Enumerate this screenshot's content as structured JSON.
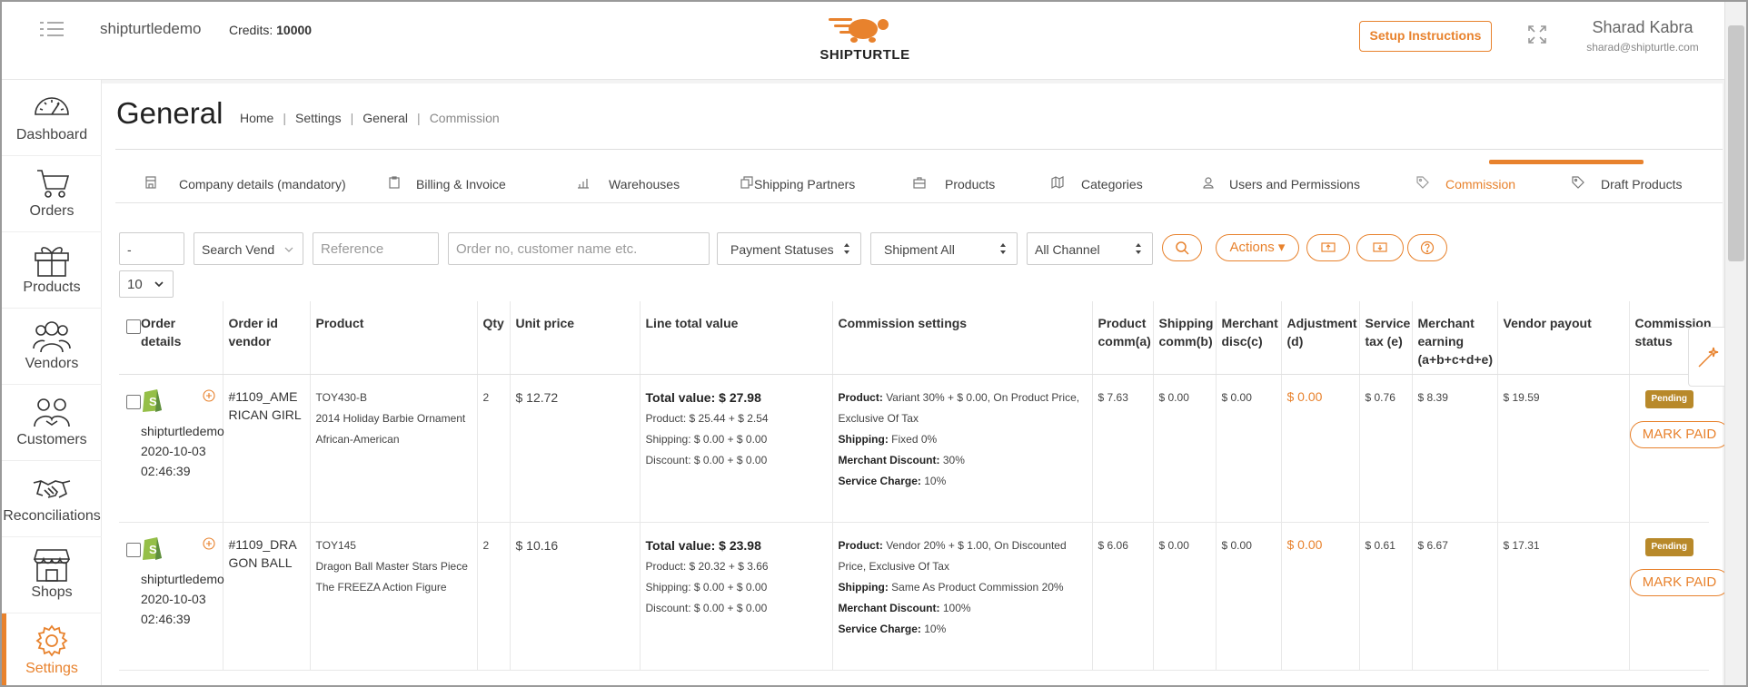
{
  "header": {
    "shop_name": "shipturtledemo",
    "credits_label": "Credits:",
    "credits_value": "10000",
    "logo_text": "SHIPTURTLE",
    "setup_button": "Setup Instructions",
    "user_name": "Sharad Kabra",
    "user_email": "sharad@shipturtle.com"
  },
  "sidebar": {
    "items": [
      {
        "label": "Dashboard",
        "icon": "speedometer-icon"
      },
      {
        "label": "Orders",
        "icon": "cart-icon"
      },
      {
        "label": "Products",
        "icon": "gift-icon"
      },
      {
        "label": "Vendors",
        "icon": "users-icon"
      },
      {
        "label": "Customers",
        "icon": "customers-icon"
      },
      {
        "label": "Reconciliations",
        "icon": "handshake-icon"
      },
      {
        "label": "Shops",
        "icon": "shop-icon"
      },
      {
        "label": "Settings",
        "icon": "gear-icon",
        "active": true
      }
    ]
  },
  "page": {
    "title": "General",
    "breadcrumb": [
      "Home",
      "Settings",
      "General",
      "Commission"
    ]
  },
  "tabs": [
    {
      "label": "Company details (mandatory)",
      "icon": "building-icon"
    },
    {
      "label": "Billing & Invoice",
      "icon": "clipboard-icon"
    },
    {
      "label": "Warehouses",
      "icon": "bar-chart-icon"
    },
    {
      "label": "Shipping Partners",
      "icon": "copy-icon"
    },
    {
      "label": "Products",
      "icon": "briefcase-icon"
    },
    {
      "label": "Categories",
      "icon": "map-icon"
    },
    {
      "label": "Users and Permissions",
      "icon": "user-icon"
    },
    {
      "label": "Commission",
      "icon": "tag-icon",
      "active": true
    },
    {
      "label": "Draft Products",
      "icon": "tag-icon"
    }
  ],
  "filters": {
    "date_value": "-",
    "vendor_select": "Search Vend",
    "reference_placeholder": "Reference",
    "search_placeholder": "Order no, customer name etc.",
    "payment_status": "Payment Statuses",
    "shipment": "Shipment All",
    "channel": "All Channel",
    "actions_label": "Actions",
    "per_page": "10"
  },
  "table": {
    "headers": [
      "Order details",
      "Order id vendor",
      "Product",
      "Qty",
      "Unit price",
      "Line total value",
      "Commission settings",
      "Product comm(a)",
      "Shipping comm(b)",
      "Merchant disc(c)",
      "Adjustment (d)",
      "Service tax (e)",
      "Merchant earning (a+b+c+d+e)",
      "Vendor payout",
      "Commission status"
    ],
    "rows": [
      {
        "shop": "shipturtledemo",
        "date": "2020-10-03",
        "time": "02:46:39",
        "order_id": "#1109_AMERICAN GIRL",
        "sku": "TOY430-B",
        "product_name": "2014 Holiday Barbie Ornament African-American",
        "qty": "2",
        "unit_price": "$ 12.72",
        "total_label": "Total value:",
        "total_value": "$ 27.98",
        "product_line": "Product: $ 25.44 + $ 2.54",
        "shipping_line": "Shipping: $ 0.00 + $ 0.00",
        "discount_line": "Discount: $ 0.00 + $ 0.00",
        "cs_product_label": "Product:",
        "cs_product": "Variant 30% + $ 0.00, On Product Price, Exclusive Of Tax",
        "cs_shipping_label": "Shipping:",
        "cs_shipping": "Fixed 0%",
        "cs_merchant_label": "Merchant Discount:",
        "cs_merchant": "30%",
        "cs_service_label": "Service Charge:",
        "cs_service": "10%",
        "product_comm": "$ 7.63",
        "shipping_comm": "$ 0.00",
        "merchant_disc": "$ 0.00",
        "adjustment": "$ 0.00",
        "service_tax": "$ 0.76",
        "merchant_earning": "$ 8.39",
        "vendor_payout": "$ 19.59",
        "status": "Pending",
        "mark_paid": "MARK PAID"
      },
      {
        "shop": "shipturtledemo",
        "date": "2020-10-03",
        "time": "02:46:39",
        "order_id": "#1109_DRAGON BALL",
        "sku": "TOY145",
        "product_name": "Dragon Ball Master Stars Piece The FREEZA Action Figure",
        "qty": "2",
        "unit_price": "$ 10.16",
        "total_label": "Total value:",
        "total_value": "$ 23.98",
        "product_line": "Product: $ 20.32 + $ 3.66",
        "shipping_line": "Shipping: $ 0.00 + $ 0.00",
        "discount_line": "Discount: $ 0.00 + $ 0.00",
        "cs_product_label": "Product:",
        "cs_product": "Vendor 20% + $ 1.00, On Discounted Price, Exclusive Of Tax",
        "cs_shipping_label": "Shipping:",
        "cs_shipping": "Same As Product Commission 20%",
        "cs_merchant_label": "Merchant Discount:",
        "cs_merchant": "100%",
        "cs_service_label": "Service Charge:",
        "cs_service": "10%",
        "product_comm": "$ 6.06",
        "shipping_comm": "$ 0.00",
        "merchant_disc": "$ 0.00",
        "adjustment": "$ 0.00",
        "service_tax": "$ 0.61",
        "merchant_earning": "$ 6.67",
        "vendor_payout": "$ 17.31",
        "status": "Pending",
        "mark_paid": "MARK PAID"
      }
    ]
  },
  "colors": {
    "accent": "#e8822d",
    "pending_badge": "#b8892a",
    "shopify_green": "#95bf47"
  }
}
